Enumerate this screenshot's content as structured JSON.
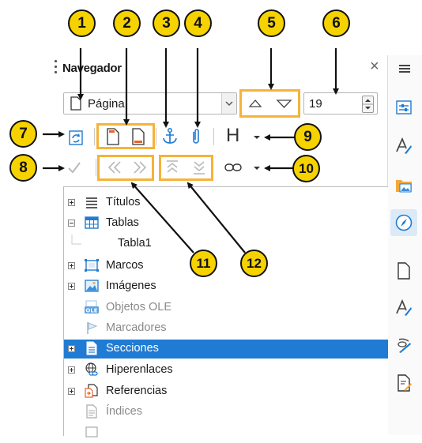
{
  "panel": {
    "title": "Navegador",
    "close_symbol": "×"
  },
  "toolbar": {
    "content_type": "Página",
    "page_number": "19",
    "heading_symbol": "H"
  },
  "tree": {
    "items": [
      {
        "label": "Títulos",
        "icon": "headings-icon",
        "expander": "plus",
        "enabled": true
      },
      {
        "label": "Tablas",
        "icon": "table-icon",
        "expander": "minus",
        "enabled": true
      },
      {
        "label": "Tabla1",
        "icon": "",
        "expander": "none",
        "enabled": true
      },
      {
        "label": "Marcos",
        "icon": "frame-icon",
        "expander": "plus",
        "enabled": true
      },
      {
        "label": "Imágenes",
        "icon": "image-icon",
        "expander": "plus",
        "enabled": true
      },
      {
        "label": "Objetos OLE",
        "icon": "ole-object-icon",
        "expander": "none",
        "enabled": false
      },
      {
        "label": "Marcadores",
        "icon": "bookmark-flag-icon",
        "expander": "none",
        "enabled": false
      },
      {
        "label": "Secciones",
        "icon": "section-icon",
        "expander": "plus",
        "enabled": true,
        "selected": true
      },
      {
        "label": "Hiperenlaces",
        "icon": "hyperlink-globe-icon",
        "expander": "plus",
        "enabled": true
      },
      {
        "label": "Referencias",
        "icon": "references-icon",
        "expander": "plus",
        "enabled": true
      },
      {
        "label": "Índices",
        "icon": "index-icon",
        "expander": "none",
        "enabled": false
      },
      {
        "label": "",
        "icon": "comment-icon",
        "expander": "none",
        "enabled": false
      }
    ]
  },
  "callouts": [
    "1",
    "2",
    "3",
    "4",
    "5",
    "6",
    "7",
    "8",
    "9",
    "10",
    "11",
    "12"
  ],
  "colors": {
    "callout_fill": "#f6d200",
    "highlight_box": "#f5b33a",
    "selection": "#1f7bd3",
    "icon_blue": "#1f7bd3"
  },
  "sidebar": {
    "icons": [
      "properties-icon",
      "styles-icon",
      "gallery-icon",
      "navigator-icon",
      "page-icon",
      "style-inspector-icon",
      "manage-changes-icon",
      "design-icon"
    ]
  }
}
